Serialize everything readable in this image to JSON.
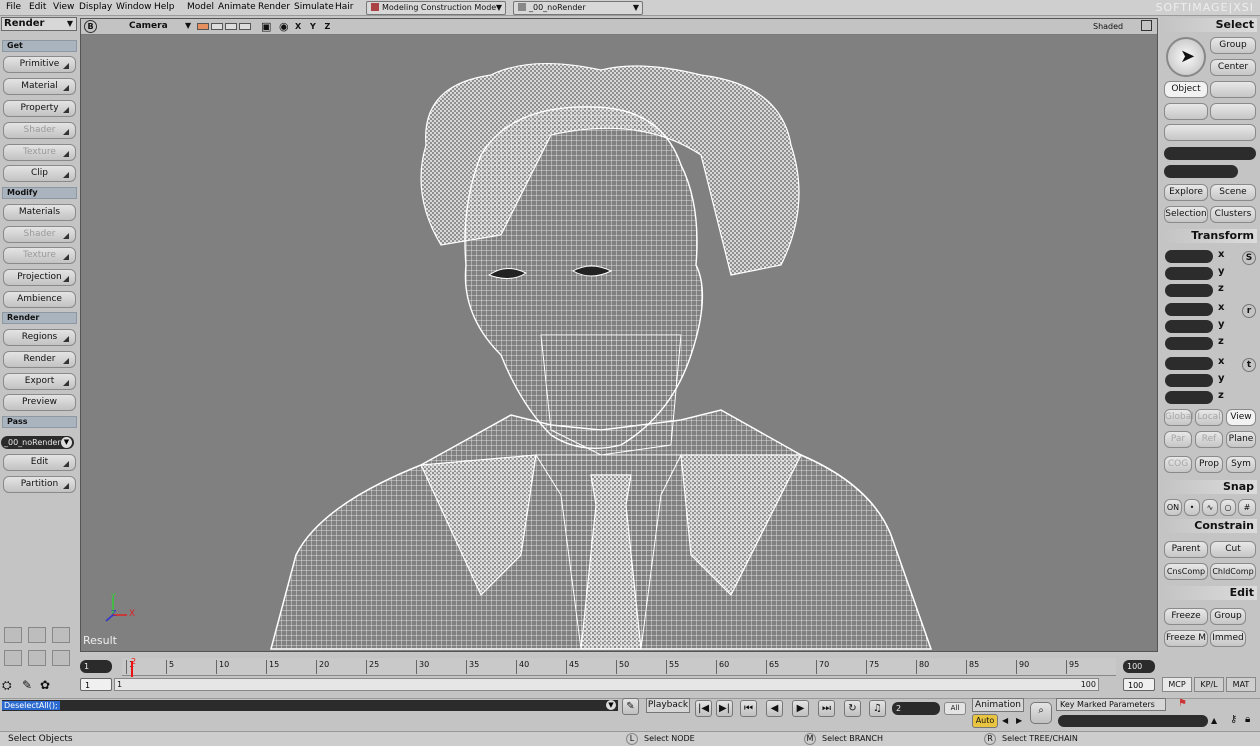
{
  "menubar": {
    "menus": [
      "File",
      "Edit",
      "View",
      "Display",
      "Window",
      "Help",
      "Model",
      "Animate",
      "Render",
      "Simulate",
      "Hair"
    ],
    "mode_select": "Modeling Construction Mode",
    "pass_select": "_00_noRender",
    "brand": "SOFTIMAGE|XSI"
  },
  "left_panel": {
    "module": "Render",
    "sections": {
      "get": "Get",
      "modify": "Modify",
      "render": "Render",
      "pass": "Pass"
    },
    "get_buttons": [
      "Primitive",
      "Material",
      "Property",
      "Shader",
      "Texture",
      "Clip"
    ],
    "modify_buttons": [
      "Materials",
      "Shader",
      "Texture",
      "Projection",
      "Ambience"
    ],
    "render_buttons": [
      "Regions",
      "Render",
      "Export",
      "Preview"
    ],
    "pass_value": "_00_noRender",
    "pass_buttons": [
      "Edit",
      "Partition"
    ]
  },
  "viewport": {
    "camera": "Camera",
    "xyz": "X Y Z",
    "display_mode": "Shaded",
    "b_label": "B",
    "result_label": "Result",
    "axis_x": "X",
    "axis_y": "Y",
    "axis_z": "Z"
  },
  "timeline": {
    "start": "1",
    "end": "100",
    "current": "1",
    "range_start": "1",
    "range_end": "100",
    "range_end2": "100",
    "ticks": [
      "1",
      "5",
      "10",
      "15",
      "20",
      "25",
      "30",
      "35",
      "40",
      "45",
      "50",
      "55",
      "60",
      "65",
      "70",
      "75",
      "80",
      "85",
      "90",
      "95"
    ],
    "playhead_frame": "2"
  },
  "right_panel": {
    "select_title": "Select",
    "group": "Group",
    "center": "Center",
    "object": "Object",
    "explore": "Explore",
    "scene": "Scene",
    "selection": "Selection",
    "clusters": "Clusters",
    "transform_title": "Transform",
    "axes": [
      "x",
      "y",
      "z"
    ],
    "transform_icons": [
      "S",
      "r",
      "t"
    ],
    "global": "Global",
    "local": "Local",
    "view": "View",
    "par": "Par",
    "ref": "Ref",
    "plane": "Plane",
    "cog": "COG",
    "prop": "Prop",
    "sym": "Sym",
    "snap_title": "Snap",
    "snap_on": "ON",
    "constrain_title": "Constrain",
    "parent": "Parent",
    "cut": "Cut",
    "cnscomp": "CnsComp",
    "chldcomp": "ChldComp",
    "edit_title": "Edit",
    "freeze": "Freeze",
    "edit_group": "Group",
    "freeze_m": "Freeze M",
    "immed": "Immed",
    "tabs": [
      "MCP",
      "KP/L",
      "MAT"
    ]
  },
  "bottom": {
    "command": "DeselectAll();",
    "playback": "Playback",
    "frame_value": "2",
    "all": "All",
    "animation": "Animation",
    "auto": "Auto",
    "key_marked": "Key Marked Parameters",
    "status_left": "Select Objects",
    "status_l_key": "L",
    "status_l": "Select NODE",
    "status_m_key": "M",
    "status_m": "Select BRANCH",
    "status_r_key": "R",
    "status_r": "Select TREE/CHAIN"
  }
}
